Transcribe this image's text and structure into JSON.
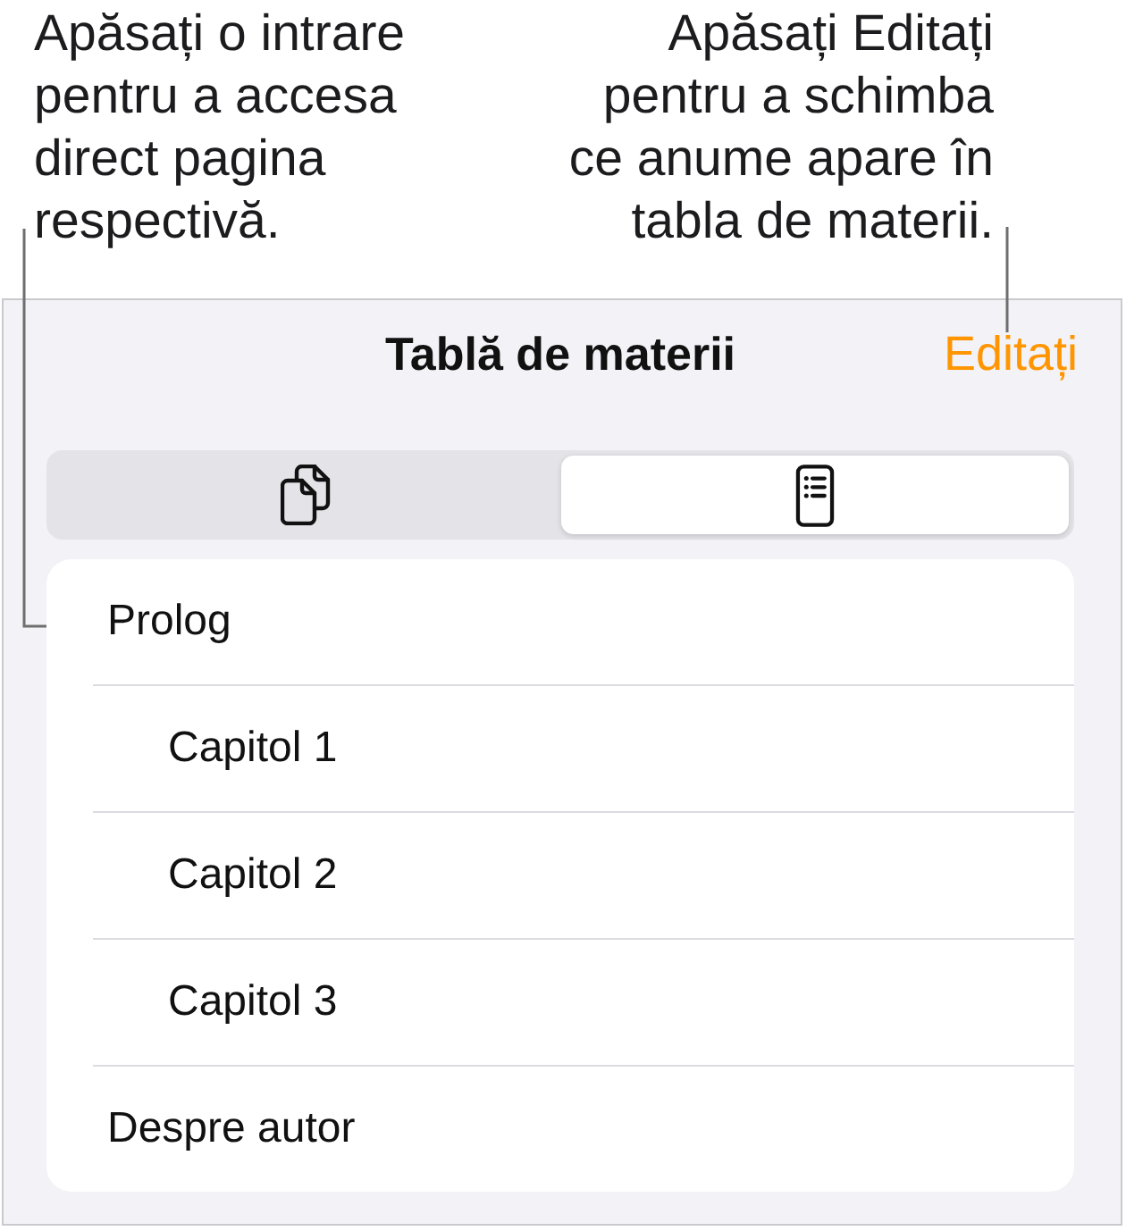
{
  "callouts": {
    "left": "Apăsați o intrare\npentru a accesa\ndirect pagina\nrespectivă.",
    "right": "Apăsați Editați\npentru a schimba\nce anume apare în\ntabla de materii."
  },
  "panel": {
    "title": "Tablă de materii",
    "edit_button": "Editați",
    "view_tabs": [
      {
        "kind": "pages",
        "selected": false
      },
      {
        "kind": "outline",
        "selected": true
      }
    ],
    "entries": [
      {
        "label": "Prolog",
        "children": [
          {
            "label": "Capitol 1"
          },
          {
            "label": "Capitol 2"
          },
          {
            "label": "Capitol 3"
          }
        ]
      },
      {
        "label": "Despre autor"
      }
    ]
  }
}
